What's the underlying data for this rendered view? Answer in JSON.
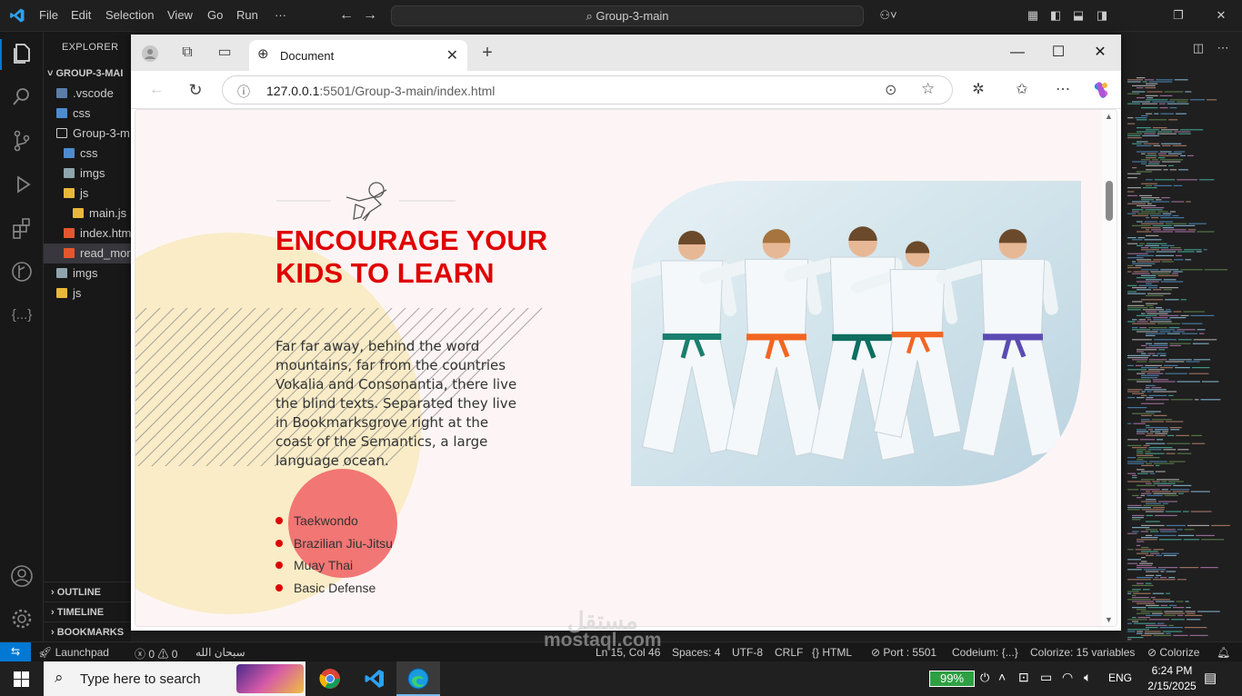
{
  "vscode": {
    "menu": [
      "File",
      "Edit",
      "Selection",
      "View",
      "Go",
      "Run",
      "···"
    ],
    "command_center": "Group-3-main",
    "explorer_title": "EXPLORER",
    "tree": [
      {
        "label": "GROUP-3-MAI",
        "kind": "root"
      },
      {
        "label": ".vscode",
        "kind": "folder"
      },
      {
        "label": "css",
        "kind": "folder"
      },
      {
        "label": "Group-3-m",
        "kind": "folder-open"
      },
      {
        "label": "css",
        "kind": "folder"
      },
      {
        "label": "imgs",
        "kind": "folder"
      },
      {
        "label": "js",
        "kind": "folder-open"
      },
      {
        "label": "main.js",
        "kind": "js"
      },
      {
        "label": "index.htm",
        "kind": "html"
      },
      {
        "label": "read_mor",
        "kind": "html"
      },
      {
        "label": "imgs",
        "kind": "folder"
      },
      {
        "label": "js",
        "kind": "folder"
      }
    ],
    "sections": [
      "OUTLINE",
      "TIMELINE",
      "BOOKMARKS"
    ],
    "status": {
      "launchpad": "Launchpad",
      "problems": "0",
      "warnings": "0",
      "arabic": "سبحان الله",
      "position": "Ln 15, Col 46",
      "spaces": "Spaces: 4",
      "encoding": "UTF-8",
      "eol": "CRLF",
      "language": "HTML",
      "port": "Port : 5501",
      "codeium": "Codeium: {...}",
      "colorize": "Colorize: 15 variables",
      "colorize2": "Colorize"
    }
  },
  "browser": {
    "tab_title": "Document",
    "url_host": "127.0.0.1",
    "url_rest": ":5501/Group-3-main/index.html"
  },
  "page": {
    "heading": "ENCOURAGE YOUR KIDS TO LEARN",
    "paragraph": "Far far away, behind the word mountains, far from the countries Vokalia and Consonantia, there live the blind texts. Separated they live in Bookmarksgrove right at the coast of the Semantics, a large language ocean.",
    "list": [
      "Taekwondo",
      "Brazilian Jiu-Jitsu",
      "Muay Thai",
      "Basic Defense"
    ],
    "colors": {
      "accent": "#e00000",
      "background": "#fdf5f5",
      "yellow_blob": "#f9ecc7",
      "red_circle": "#f07070"
    }
  },
  "taskbar": {
    "search_placeholder": "Type here to search",
    "battery": "99%",
    "language": "ENG",
    "time": "6:24 PM",
    "date": "2/15/2025"
  },
  "watermark": {
    "line1": "مستقل",
    "line2": "mostaql.com"
  }
}
